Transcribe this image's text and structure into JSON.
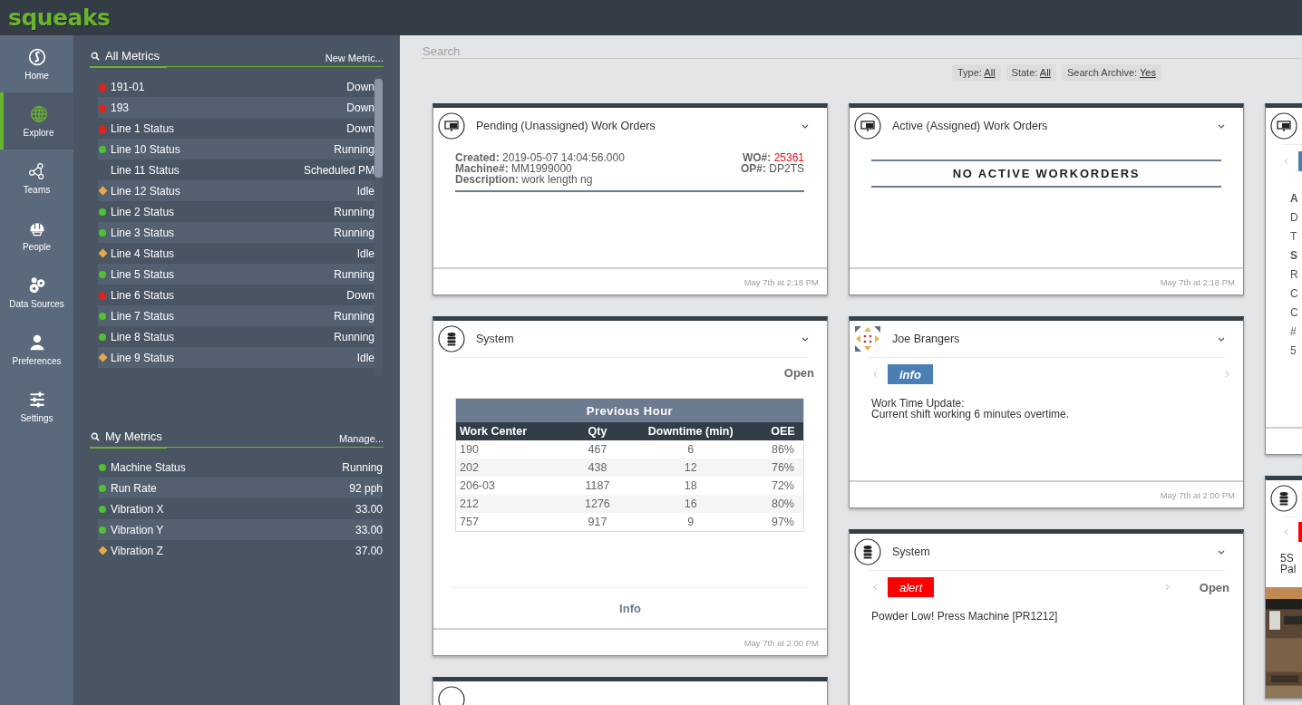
{
  "logo": "squeaks",
  "nav": [
    {
      "label": "Home",
      "kind": "home",
      "selected": false
    },
    {
      "label": "Explore",
      "kind": "globe",
      "selected": true
    },
    {
      "label": "Teams",
      "kind": "teams",
      "selected": false
    },
    {
      "label": "People",
      "kind": "helmet",
      "selected": false
    },
    {
      "label": "Data Sources",
      "kind": "gears",
      "selected": false
    },
    {
      "label": "Preferences",
      "kind": "person",
      "selected": false
    },
    {
      "label": "Settings",
      "kind": "sliders",
      "selected": false
    }
  ],
  "all_metrics": {
    "title": "All Metrics",
    "action": "New Metric...",
    "rows": [
      {
        "name": "191-01",
        "value": "Down",
        "kind": "down"
      },
      {
        "name": "193",
        "value": "Down",
        "kind": "down"
      },
      {
        "name": "Line 1 Status",
        "value": "Down",
        "kind": "down"
      },
      {
        "name": "Line 10 Status",
        "value": "Running",
        "kind": "running"
      },
      {
        "name": "Line 11 Status",
        "value": "Scheduled PM",
        "kind": "none"
      },
      {
        "name": "Line 12 Status",
        "value": "Idle",
        "kind": "idle"
      },
      {
        "name": "Line 2 Status",
        "value": "Running",
        "kind": "running"
      },
      {
        "name": "Line 3 Status",
        "value": "Running",
        "kind": "running"
      },
      {
        "name": "Line 4 Status",
        "value": "Idle",
        "kind": "idle"
      },
      {
        "name": "Line 5 Status",
        "value": "Running",
        "kind": "running"
      },
      {
        "name": "Line 6 Status",
        "value": "Down",
        "kind": "down"
      },
      {
        "name": "Line 7 Status",
        "value": "Running",
        "kind": "running"
      },
      {
        "name": "Line 8 Status",
        "value": "Running",
        "kind": "running"
      },
      {
        "name": "Line 9 Status",
        "value": "Idle",
        "kind": "idle"
      }
    ]
  },
  "my_metrics": {
    "title": "My Metrics",
    "action": "Manage...",
    "rows": [
      {
        "name": "Machine Status",
        "value": "Running",
        "kind": "running"
      },
      {
        "name": "Run Rate",
        "value": "92 pph",
        "kind": "running"
      },
      {
        "name": "Vibration X",
        "value": "33.00",
        "kind": "running"
      },
      {
        "name": "Vibration Y",
        "value": "33.00",
        "kind": "running"
      },
      {
        "name": "Vibration Z",
        "value": "37.00",
        "kind": "idle"
      }
    ]
  },
  "search": {
    "placeholder": "Search"
  },
  "filters": [
    {
      "label": "Type:",
      "value": "All"
    },
    {
      "label": "State:",
      "value": "All"
    },
    {
      "label": "Search Archive:",
      "value": "Yes"
    }
  ],
  "columns": [
    [
      {
        "kind": "workorders",
        "header": {
          "kind": "workorders"
        },
        "title": "Pending (Unassigned) Work Orders",
        "timestamp": "May 7th at 2:18 PM",
        "left": [
          {
            "label": "Created:",
            "value": "2019-05-07 14:04:56.000",
            "emphasis": false
          },
          {
            "label": "Machine#:",
            "value": "MM1999000",
            "emphasis": false
          },
          {
            "label": "Description:",
            "value": "work length ng",
            "emphasis": false
          }
        ],
        "right": [
          {
            "label": "WO#:",
            "value": "25361",
            "emphasis": true
          },
          {
            "label": "OP#:",
            "value": "DP2TS",
            "emphasis": false
          }
        ]
      },
      {
        "kind": "table",
        "header": {
          "kind": "system"
        },
        "title": "System",
        "timestamp": "May 7th at 2:00 PM",
        "action": "Open",
        "link": "Info",
        "table": {
          "title": "Previous Hour",
          "columns": [
            "Work Center",
            "Qty",
            "Downtime (min)",
            "OEE"
          ],
          "rows": [
            [
              "190",
              "467",
              "6",
              "86%"
            ],
            [
              "202",
              "438",
              "12",
              "76%"
            ],
            [
              "206-03",
              "1187",
              "18",
              "72%"
            ],
            [
              "212",
              "1276",
              "16",
              "80%"
            ],
            [
              "757",
              "917",
              "9",
              "97%"
            ]
          ]
        }
      },
      {
        "kind": "stub",
        "header": {
          "kind": "unknown"
        }
      }
    ],
    [
      {
        "kind": "empty",
        "header": {
          "kind": "workorders"
        },
        "title": "Active (Assigned) Work Orders",
        "timestamp": "May 7th at 2:18 PM",
        "notice": "NO ACTIVE WORKORDERS"
      },
      {
        "kind": "message",
        "header": {
          "kind": "user"
        },
        "title": "Joe Brangers",
        "timestamp": "May 7th at 2:00 PM",
        "badge": {
          "label": "info",
          "kind": "info"
        },
        "lines": [
          "Work Time Update:",
          "Current shift working 6 minutes overtime."
        ]
      },
      {
        "kind": "message",
        "header": {
          "kind": "system"
        },
        "title": "System",
        "badge": {
          "label": "alert",
          "kind": "alert"
        },
        "action": "Open",
        "lines": [
          "Powder Low! Press Machine [PR1212]"
        ]
      }
    ],
    [
      {
        "kind": "fragment",
        "header": {
          "kind": "workorders"
        },
        "badge": {
          "kind": "info"
        },
        "letters": [
          {
            "text": "A",
            "bold": true
          },
          {
            "text": "D",
            "bold": false
          },
          {
            "text": "T",
            "bold": false
          },
          {
            "text": "S",
            "bold": true
          },
          {
            "text": "R",
            "bold": false
          },
          {
            "text": "C",
            "bold": false
          },
          {
            "text": "C",
            "bold": false
          },
          {
            "text": "#",
            "bold": false
          },
          {
            "text": "5",
            "bold": false
          }
        ]
      },
      {
        "kind": "message",
        "header": {
          "kind": "system"
        },
        "badge": {
          "kind": "alert"
        },
        "lines": [
          "5S",
          "Pal"
        ],
        "picture": true
      }
    ]
  ]
}
